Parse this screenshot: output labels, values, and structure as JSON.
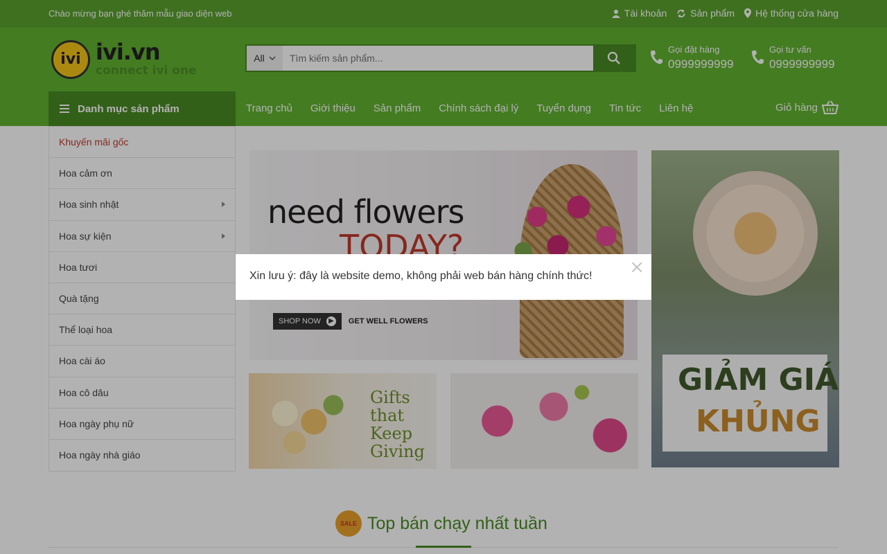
{
  "topbar": {
    "welcome": "Chào mừng bạn ghé thăm mẫu giao diện web",
    "links": [
      {
        "label": "Tài khoản",
        "icon": "user-icon"
      },
      {
        "label": "Sản phẩm",
        "icon": "refresh-icon"
      },
      {
        "label": "Hệ thống cửa hàng",
        "icon": "map-pin-icon"
      }
    ]
  },
  "logo": {
    "icon_text": "ivi",
    "brand": "ivi.vn",
    "tagline": "connect ivi one"
  },
  "search": {
    "category": "All",
    "placeholder": "Tìm kiếm sản phẩm..."
  },
  "hotlines": [
    {
      "label": "Gọi đặt hàng",
      "number": "0999999999"
    },
    {
      "label": "Gọi tư vấn",
      "number": "0999999999"
    }
  ],
  "nav": {
    "category_button": "Danh mục sản phẩm",
    "items": [
      "Trang chủ",
      "Giới thiệu",
      "Sản phẩm",
      "Chính sách đại lý",
      "Tuyển dụng",
      "Tin tức",
      "Liên hệ"
    ],
    "cart_label": "Giỏ hàng"
  },
  "sidebar": {
    "items": [
      {
        "label": "Khuyến mãi gốc",
        "has_submenu": false
      },
      {
        "label": "Hoa cảm ơn",
        "has_submenu": false
      },
      {
        "label": "Hoa sinh nhật",
        "has_submenu": true
      },
      {
        "label": "Hoa sự kiện",
        "has_submenu": true
      },
      {
        "label": "Hoa tươi",
        "has_submenu": false
      },
      {
        "label": "Quà tặng",
        "has_submenu": false
      },
      {
        "label": "Thể loại hoa",
        "has_submenu": false
      },
      {
        "label": "Hoa cài áo",
        "has_submenu": false
      },
      {
        "label": "Hoa cô dâu",
        "has_submenu": false
      },
      {
        "label": "Hoa ngày phụ nữ",
        "has_submenu": false
      },
      {
        "label": "Hoa ngày nhà giáo",
        "has_submenu": false
      }
    ]
  },
  "banners": {
    "main": {
      "line1": "need flowers",
      "line2": "TODAY?",
      "button": "SHOP NOW",
      "caption": "GET WELL FLOWERS"
    },
    "right": {
      "line1": "GIẢM GIÁ",
      "line2": "KHỦNG"
    },
    "small1": {
      "text": "Gifts that Keep Giving"
    }
  },
  "section": {
    "title": "Top bán chạy nhất tuần",
    "badge": "SALE"
  },
  "modal": {
    "message": "Xin lưu ý: đây là website demo, không phải web bán hàng chính thức!",
    "close": "×"
  },
  "colors": {
    "primary_green": "#62b232",
    "dark_green": "#4a8a23",
    "accent_red": "#c0392b"
  }
}
